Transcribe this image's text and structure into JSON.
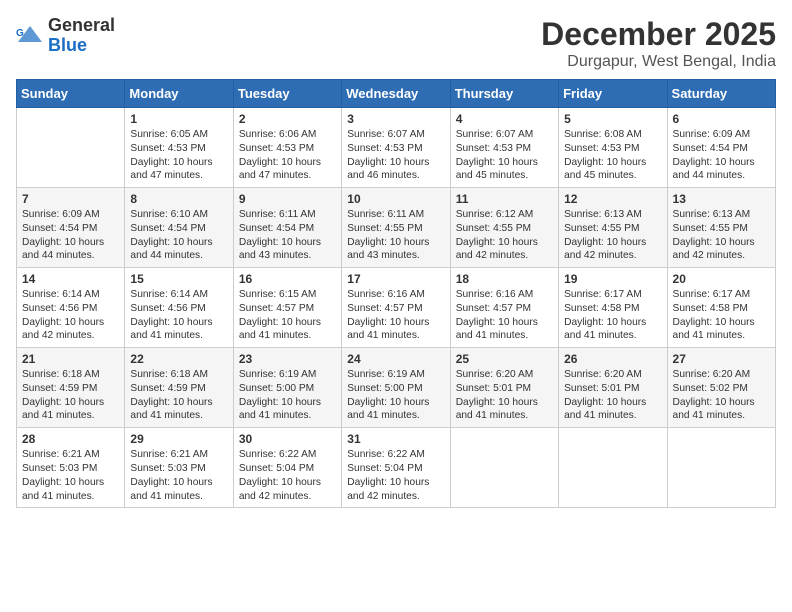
{
  "header": {
    "logo_general": "General",
    "logo_blue": "Blue",
    "month_year": "December 2025",
    "location": "Durgapur, West Bengal, India"
  },
  "days_of_week": [
    "Sunday",
    "Monday",
    "Tuesday",
    "Wednesday",
    "Thursday",
    "Friday",
    "Saturday"
  ],
  "weeks": [
    [
      {
        "day": "",
        "info": ""
      },
      {
        "day": "1",
        "info": "Sunrise: 6:05 AM\nSunset: 4:53 PM\nDaylight: 10 hours and 47 minutes."
      },
      {
        "day": "2",
        "info": "Sunrise: 6:06 AM\nSunset: 4:53 PM\nDaylight: 10 hours and 47 minutes."
      },
      {
        "day": "3",
        "info": "Sunrise: 6:07 AM\nSunset: 4:53 PM\nDaylight: 10 hours and 46 minutes."
      },
      {
        "day": "4",
        "info": "Sunrise: 6:07 AM\nSunset: 4:53 PM\nDaylight: 10 hours and 45 minutes."
      },
      {
        "day": "5",
        "info": "Sunrise: 6:08 AM\nSunset: 4:53 PM\nDaylight: 10 hours and 45 minutes."
      },
      {
        "day": "6",
        "info": "Sunrise: 6:09 AM\nSunset: 4:54 PM\nDaylight: 10 hours and 44 minutes."
      }
    ],
    [
      {
        "day": "7",
        "info": "Sunrise: 6:09 AM\nSunset: 4:54 PM\nDaylight: 10 hours and 44 minutes."
      },
      {
        "day": "8",
        "info": "Sunrise: 6:10 AM\nSunset: 4:54 PM\nDaylight: 10 hours and 44 minutes."
      },
      {
        "day": "9",
        "info": "Sunrise: 6:11 AM\nSunset: 4:54 PM\nDaylight: 10 hours and 43 minutes."
      },
      {
        "day": "10",
        "info": "Sunrise: 6:11 AM\nSunset: 4:55 PM\nDaylight: 10 hours and 43 minutes."
      },
      {
        "day": "11",
        "info": "Sunrise: 6:12 AM\nSunset: 4:55 PM\nDaylight: 10 hours and 42 minutes."
      },
      {
        "day": "12",
        "info": "Sunrise: 6:13 AM\nSunset: 4:55 PM\nDaylight: 10 hours and 42 minutes."
      },
      {
        "day": "13",
        "info": "Sunrise: 6:13 AM\nSunset: 4:55 PM\nDaylight: 10 hours and 42 minutes."
      }
    ],
    [
      {
        "day": "14",
        "info": "Sunrise: 6:14 AM\nSunset: 4:56 PM\nDaylight: 10 hours and 42 minutes."
      },
      {
        "day": "15",
        "info": "Sunrise: 6:14 AM\nSunset: 4:56 PM\nDaylight: 10 hours and 41 minutes."
      },
      {
        "day": "16",
        "info": "Sunrise: 6:15 AM\nSunset: 4:57 PM\nDaylight: 10 hours and 41 minutes."
      },
      {
        "day": "17",
        "info": "Sunrise: 6:16 AM\nSunset: 4:57 PM\nDaylight: 10 hours and 41 minutes."
      },
      {
        "day": "18",
        "info": "Sunrise: 6:16 AM\nSunset: 4:57 PM\nDaylight: 10 hours and 41 minutes."
      },
      {
        "day": "19",
        "info": "Sunrise: 6:17 AM\nSunset: 4:58 PM\nDaylight: 10 hours and 41 minutes."
      },
      {
        "day": "20",
        "info": "Sunrise: 6:17 AM\nSunset: 4:58 PM\nDaylight: 10 hours and 41 minutes."
      }
    ],
    [
      {
        "day": "21",
        "info": "Sunrise: 6:18 AM\nSunset: 4:59 PM\nDaylight: 10 hours and 41 minutes."
      },
      {
        "day": "22",
        "info": "Sunrise: 6:18 AM\nSunset: 4:59 PM\nDaylight: 10 hours and 41 minutes."
      },
      {
        "day": "23",
        "info": "Sunrise: 6:19 AM\nSunset: 5:00 PM\nDaylight: 10 hours and 41 minutes."
      },
      {
        "day": "24",
        "info": "Sunrise: 6:19 AM\nSunset: 5:00 PM\nDaylight: 10 hours and 41 minutes."
      },
      {
        "day": "25",
        "info": "Sunrise: 6:20 AM\nSunset: 5:01 PM\nDaylight: 10 hours and 41 minutes."
      },
      {
        "day": "26",
        "info": "Sunrise: 6:20 AM\nSunset: 5:01 PM\nDaylight: 10 hours and 41 minutes."
      },
      {
        "day": "27",
        "info": "Sunrise: 6:20 AM\nSunset: 5:02 PM\nDaylight: 10 hours and 41 minutes."
      }
    ],
    [
      {
        "day": "28",
        "info": "Sunrise: 6:21 AM\nSunset: 5:03 PM\nDaylight: 10 hours and 41 minutes."
      },
      {
        "day": "29",
        "info": "Sunrise: 6:21 AM\nSunset: 5:03 PM\nDaylight: 10 hours and 41 minutes."
      },
      {
        "day": "30",
        "info": "Sunrise: 6:22 AM\nSunset: 5:04 PM\nDaylight: 10 hours and 42 minutes."
      },
      {
        "day": "31",
        "info": "Sunrise: 6:22 AM\nSunset: 5:04 PM\nDaylight: 10 hours and 42 minutes."
      },
      {
        "day": "",
        "info": ""
      },
      {
        "day": "",
        "info": ""
      },
      {
        "day": "",
        "info": ""
      }
    ]
  ]
}
